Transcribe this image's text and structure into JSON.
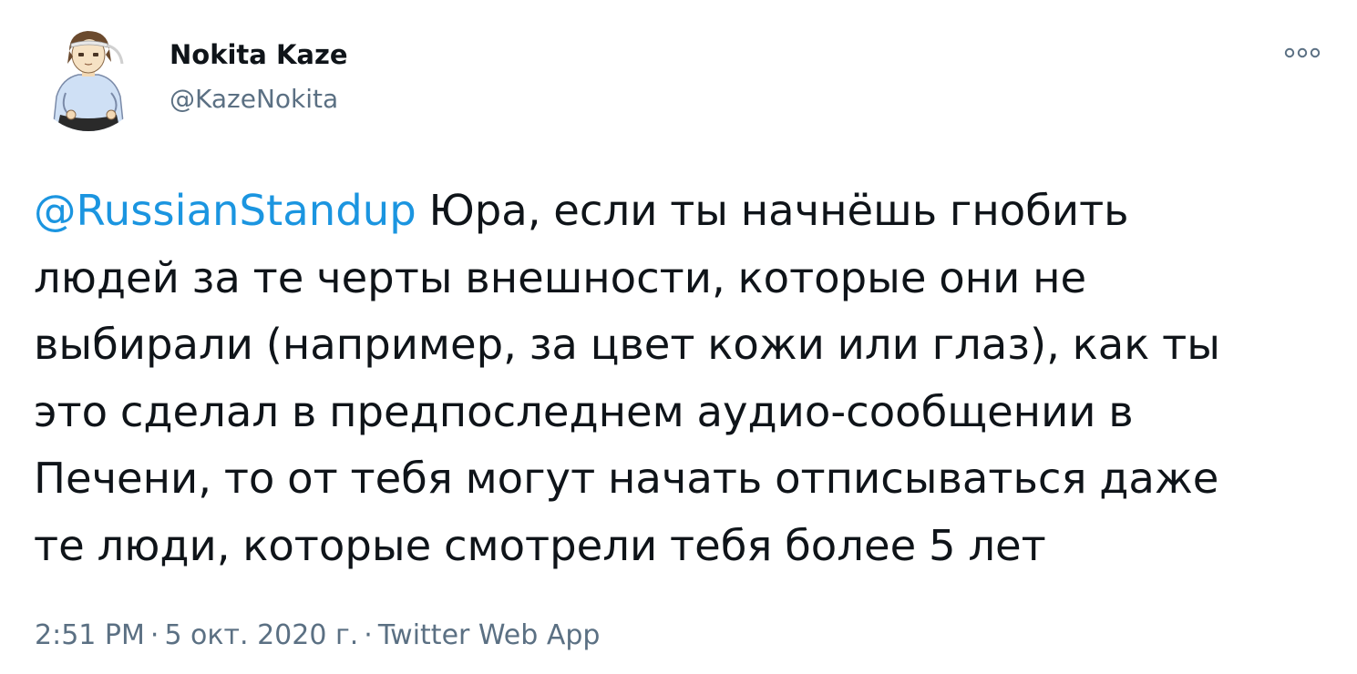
{
  "author": {
    "display_name": "Nokita Kaze",
    "handle": "@KazeNokita",
    "avatar_icon": "anime-character-avatar"
  },
  "more_button": {
    "icon": "more-options-icon"
  },
  "tweet": {
    "mention": "@RussianStandup",
    "lines": [
      " Юра, если ты начнёшь гнобить",
      "людей за те черты внешности, которые они не",
      "выбирали (например, за цвет кожи или глаз), как ты",
      "это сделал в предпоследнем аудио-сообщении в",
      "Печени, то от тебя могут начать отписываться даже",
      "те люди, которые смотрели тебя более 5 лет"
    ]
  },
  "meta": {
    "time": "2:51 PM",
    "separator": "·",
    "date": "5 окт. 2020 г.",
    "source": "Twitter Web App"
  },
  "colors": {
    "link": "#1b95e0",
    "secondary_text": "#5b7083",
    "primary_text": "#0f1419"
  }
}
